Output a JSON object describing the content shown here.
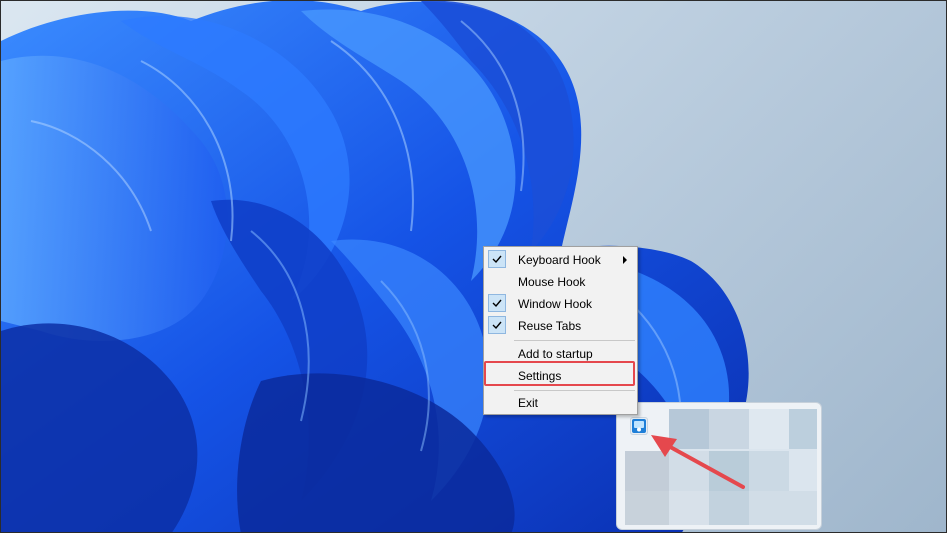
{
  "context_menu": {
    "items": [
      {
        "label": "Keyboard Hook",
        "checked": true,
        "submenu": true
      },
      {
        "label": "Mouse Hook",
        "checked": false,
        "submenu": false
      },
      {
        "label": "Window Hook",
        "checked": true,
        "submenu": false
      },
      {
        "label": "Reuse Tabs",
        "checked": true,
        "submenu": false
      },
      {
        "label": "Add to startup",
        "checked": false,
        "submenu": false
      },
      {
        "label": "Settings",
        "checked": false,
        "submenu": false,
        "highlighted": true
      },
      {
        "label": "Exit",
        "checked": false,
        "submenu": false
      }
    ]
  },
  "tray": {
    "app_icon": "tray-app-icon",
    "blurred": true
  },
  "annotations": {
    "highlight_color": "#e5484d",
    "arrow_color": "#e5484d"
  },
  "colors": {
    "wallpaper_blue": "#1f5ef0",
    "menu_background": "#f2f2f2",
    "check_background": "#cce4f7"
  }
}
